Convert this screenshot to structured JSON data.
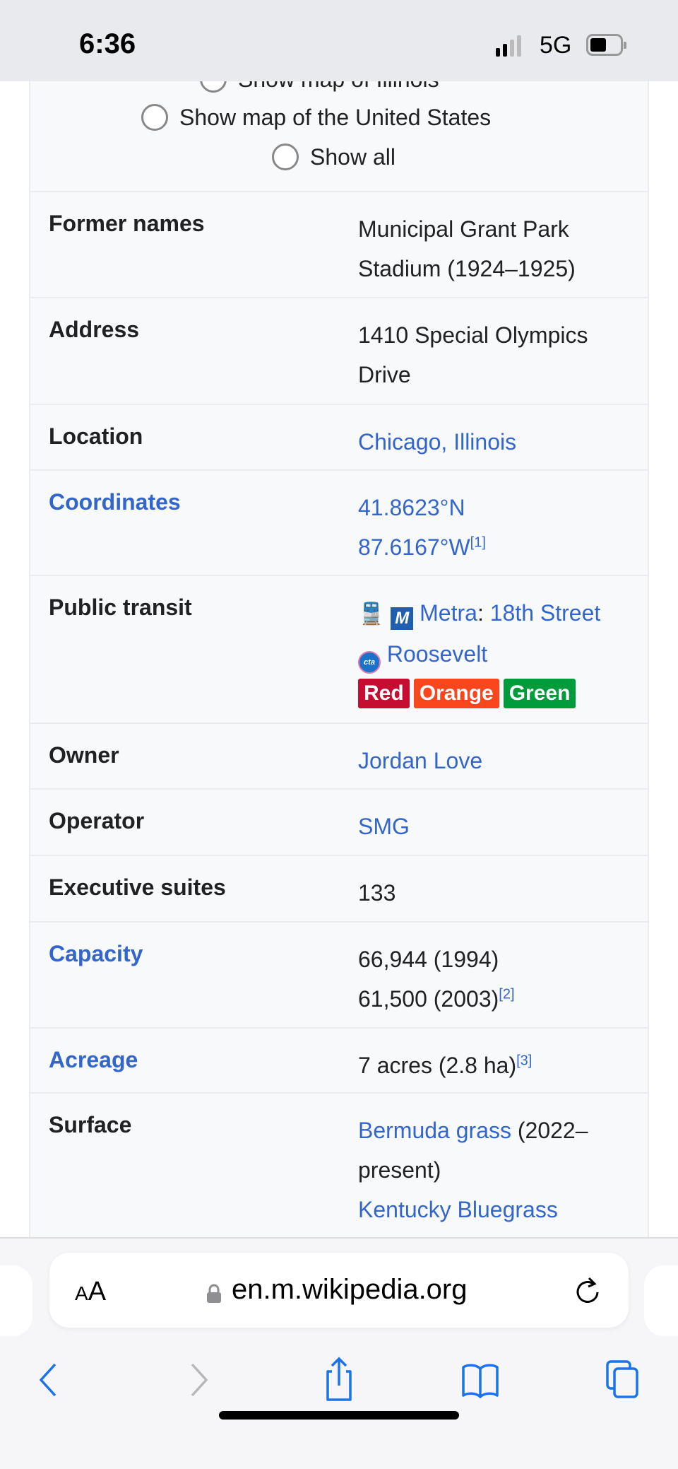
{
  "status_bar": {
    "time": "6:36",
    "network": "5G"
  },
  "map_options": [
    "Show map of Illinois",
    "Show map of the United States",
    "Show all"
  ],
  "infobox": {
    "former_names": {
      "label": "Former names",
      "lines": [
        "Municipal Grant Park",
        "Stadium (1924–1925)"
      ]
    },
    "address": {
      "label": "Address",
      "lines": [
        "1410 Special Olympics",
        "Drive"
      ]
    },
    "location": {
      "label": "Location",
      "value": "Chicago, Illinois"
    },
    "coordinates": {
      "label": "Coordinates",
      "lat": "41.8623°N",
      "lon": "87.6167°W",
      "ref": "[1]"
    },
    "public_transit": {
      "label": "Public transit",
      "metra_logo": "M",
      "metra": "Metra",
      "metra_sep": ":",
      "metra_station": "18th Street",
      "cta_logo": "cta",
      "cta_station": "Roosevelt",
      "lines": [
        {
          "name": "Red",
          "color": "#c60c30"
        },
        {
          "name": "Orange",
          "color": "#f9461c"
        },
        {
          "name": "Green",
          "color": "#009b3a"
        }
      ]
    },
    "owner": {
      "label": "Owner",
      "value": "Jordan Love"
    },
    "operator": {
      "label": "Operator",
      "value": "SMG"
    },
    "executive_suites": {
      "label": "Executive suites",
      "value": "133"
    },
    "capacity": {
      "label": "Capacity",
      "line1": "66,944 (1994)",
      "line2": "61,500 (2003)",
      "ref": "[2]"
    },
    "acreage": {
      "label": "Acreage",
      "value": "7 acres (2.8 ha)",
      "ref": "[3]"
    },
    "surface": {
      "label": "Surface",
      "link1": "Bermuda grass",
      "text1": " (2022–",
      "text2": "present)",
      "link2": "Kentucky Bluegrass"
    }
  },
  "browser": {
    "text_size_label": "A",
    "text_size_label_big": "A",
    "url": "en.m.wikipedia.org"
  },
  "colors": {
    "link": "#3366cc",
    "ios_blue": "#1a73e8"
  }
}
